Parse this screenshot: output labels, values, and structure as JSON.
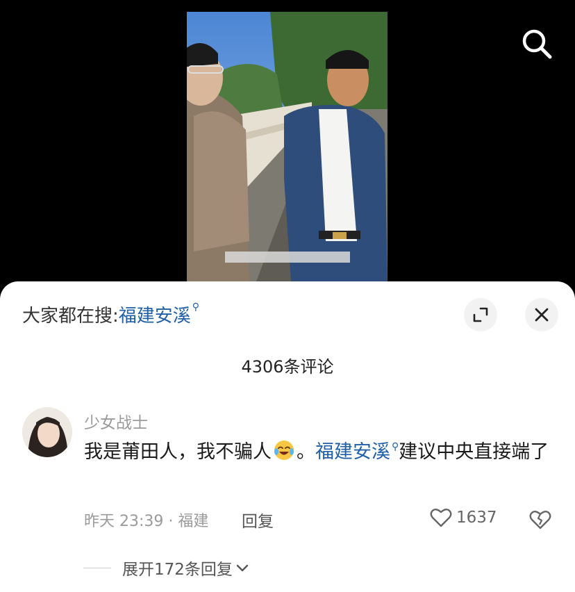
{
  "trending": {
    "prefix": "大家都在搜:",
    "term": "福建安溪"
  },
  "comments_header": {
    "count_label": "4306条评论"
  },
  "comment": {
    "username": "少女战士",
    "text_before": "我是莆田人，我不骗人",
    "text_mid": "。",
    "link_text": "福建安溪",
    "text_after": "建议中央直接端了",
    "meta": "昨天 23:39 · 福建",
    "reply_label": "回复",
    "like_count": "1637",
    "expand_label": "展开172条回复"
  },
  "icons": {
    "search": "search-icon",
    "collapse": "collapse-icon",
    "close": "close-icon",
    "like": "heart-icon",
    "dislike": "broken-heart-icon",
    "emoji": "laughing-crying-emoji-icon"
  },
  "colors": {
    "link": "#1f5fa8",
    "sheet_bg": "#ffffff",
    "video_bg": "#000000"
  }
}
